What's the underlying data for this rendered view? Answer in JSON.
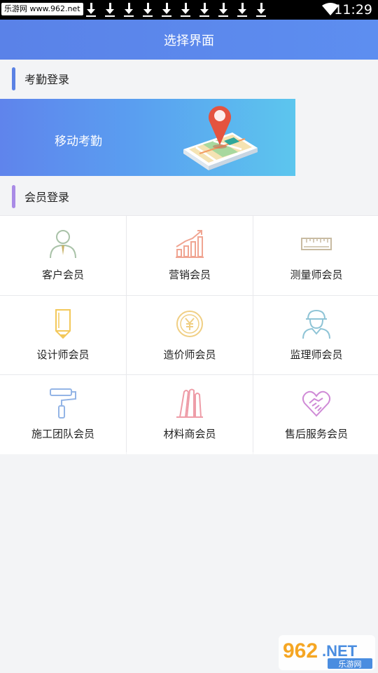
{
  "status_bar": {
    "badge": "乐游网 www.962.net",
    "time": "11:29",
    "download_icons": [
      "download-icon",
      "download-icon",
      "download-icon",
      "download-icon",
      "download-icon",
      "download-icon",
      "download-icon",
      "download-icon",
      "download-icon",
      "download-icon"
    ]
  },
  "header": {
    "title": "选择界面"
  },
  "attendance": {
    "section_title": "考勤登录",
    "bar_color": "#5b82e4",
    "banner_label": "移动考勤"
  },
  "member": {
    "section_title": "会员登录",
    "bar_color": "#a98be6",
    "items": [
      {
        "label": "客户会员",
        "icon": "customer-icon",
        "color": "#a9c2a8"
      },
      {
        "label": "营销会员",
        "icon": "growth-chart-icon",
        "color": "#f0a592"
      },
      {
        "label": "测量师会员",
        "icon": "ruler-icon",
        "color": "#c8bba2"
      },
      {
        "label": "设计师会员",
        "icon": "pencil-icon",
        "color": "#f3c85a"
      },
      {
        "label": "造价师会员",
        "icon": "yuan-coin-icon",
        "color": "#f0cf84"
      },
      {
        "label": "监理师会员",
        "icon": "hardhat-worker-icon",
        "color": "#8fc4d6"
      },
      {
        "label": "施工团队会员",
        "icon": "paint-roller-icon",
        "color": "#94b5e6"
      },
      {
        "label": "材料商会员",
        "icon": "material-rolls-icon",
        "color": "#ee9da8"
      },
      {
        "label": "售后服务会员",
        "icon": "heart-handshake-icon",
        "color": "#cf8ad6"
      }
    ]
  },
  "watermark": {
    "brand": "962",
    "suffix": ".NET",
    "subtitle": "乐游网"
  }
}
